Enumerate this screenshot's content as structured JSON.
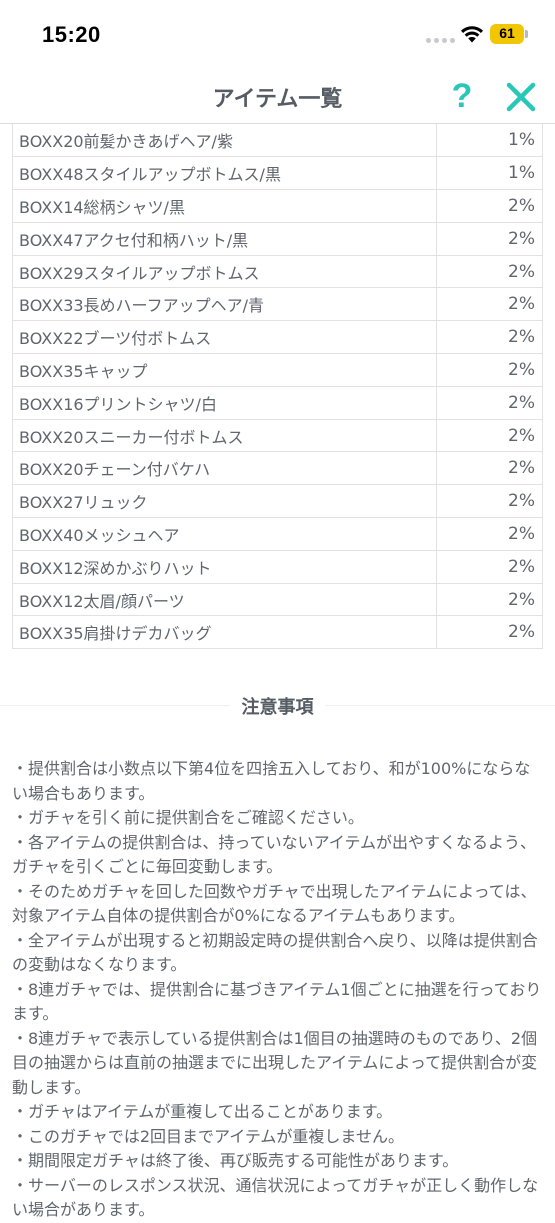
{
  "status_bar": {
    "time": "15:20",
    "battery_level": "61",
    "battery_color": "#f2c600",
    "signal_icon": "signal-dots-icon",
    "wifi_icon": "wifi-icon"
  },
  "header": {
    "title": "アイテム一覧",
    "help_label": "?",
    "help_icon": "question-mark-icon",
    "close_icon": "close-icon",
    "accent_color": "#29c7b8"
  },
  "items": [
    {
      "name": "BOXX20前髪かきあげヘア/紫",
      "rate": "1%"
    },
    {
      "name": "BOXX48スタイルアップボトムス/黒",
      "rate": "1%"
    },
    {
      "name": "BOXX14総柄シャツ/黒",
      "rate": "2%"
    },
    {
      "name": "BOXX47アクセ付和柄ハット/黒",
      "rate": "2%"
    },
    {
      "name": "BOXX29スタイルアップボトムス",
      "rate": "2%"
    },
    {
      "name": "BOXX33長めハーフアップヘア/青",
      "rate": "2%"
    },
    {
      "name": "BOXX22ブーツ付ボトムス",
      "rate": "2%"
    },
    {
      "name": "BOXX35キャップ",
      "rate": "2%"
    },
    {
      "name": "BOXX16プリントシャツ/白",
      "rate": "2%"
    },
    {
      "name": "BOXX20スニーカー付ボトムス",
      "rate": "2%"
    },
    {
      "name": "BOXX20チェーン付バケハ",
      "rate": "2%"
    },
    {
      "name": "BOXX27リュック",
      "rate": "2%"
    },
    {
      "name": "BOXX40メッシュヘア",
      "rate": "2%"
    },
    {
      "name": "BOXX12深めかぶりハット",
      "rate": "2%"
    },
    {
      "name": "BOXX12太眉/顔パーツ",
      "rate": "2%"
    },
    {
      "name": "BOXX35肩掛けデカバッグ",
      "rate": "2%"
    }
  ],
  "notice": {
    "title": "注意事項",
    "lines": [
      "・提供割合は小数点以下第4位を四捨五入しており、和が100%にならない場合もあります。",
      "・ガチャを引く前に提供割合をご確認ください。",
      "・各アイテムの提供割合は、持っていないアイテムが出やすくなるよう、ガチャを引くごとに毎回変動します。",
      "・そのためガチャを回した回数やガチャで出現したアイテムによっては、対象アイテム自体の提供割合が0%になるアイテムもあります。",
      "・全アイテムが出現すると初期設定時の提供割合へ戻り、以降は提供割合の変動はなくなります。",
      "・8連ガチャでは、提供割合に基づきアイテム1個ごとに抽選を行っております。",
      "・8連ガチャで表示している提供割合は1個目の抽選時のものであり、2個目の抽選からは直前の抽選までに出現したアイテムによって提供割合が変動します。",
      "・ガチャはアイテムが重複して出ることがあります。",
      "・このガチャでは2回目までアイテムが重複しません。",
      "・期間限定ガチャは終了後、再び販売する可能性があります。",
      "・サーバーのレスポンス状況、通信状況によってガチャが正しく動作しない場合があります。"
    ]
  }
}
